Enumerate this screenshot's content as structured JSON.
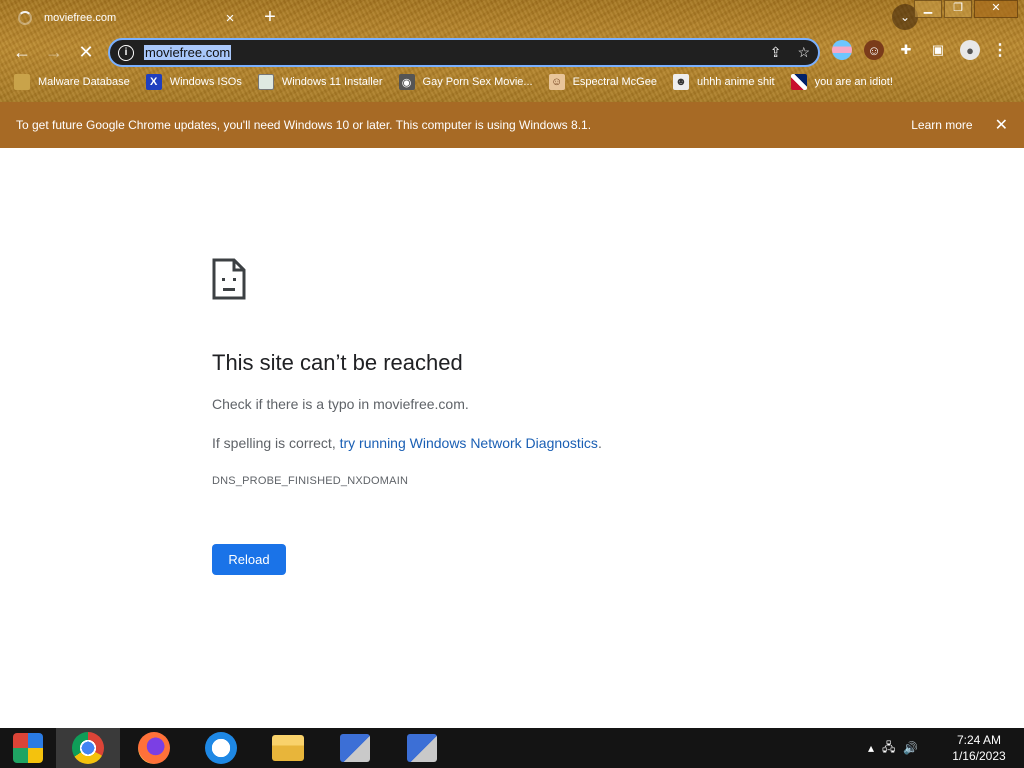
{
  "browser": {
    "tab_title": "moviefree.com",
    "tab_close": "×",
    "new_tab": "+",
    "address": "moviefree.com",
    "bookmarks": [
      {
        "label": "Malware Database",
        "icon": "folder-icon"
      },
      {
        "label": "Windows ISOs",
        "icon": "x-logo-icon"
      },
      {
        "label": "Windows 11 Installer",
        "icon": "image-icon"
      },
      {
        "label": "Gay Porn Sex Movie...",
        "icon": "robot-icon"
      },
      {
        "label": "Espectral McGee",
        "icon": "face-icon"
      },
      {
        "label": "uhhh anime shit",
        "icon": "anime-face-icon"
      },
      {
        "label": "you are an idiot!",
        "icon": "flag-icon"
      }
    ]
  },
  "infobar": {
    "message": "To get future Google Chrome updates, you'll need Windows 10 or later. This computer is using Windows 8.1.",
    "learn_more": "Learn more",
    "close": "✕"
  },
  "error_page": {
    "title": "This site can’t be reached",
    "line1": "Check if there is a typo in moviefree.com.",
    "line2_prefix": "If spelling is correct, ",
    "line2_link": "try running Windows Network Diagnostics",
    "line2_suffix": ".",
    "code": "DNS_PROBE_FINISHED_NXDOMAIN",
    "reload_label": "Reload"
  },
  "taskbar": {
    "items": [
      "start-orb",
      "chrome",
      "firefox",
      "browser-o",
      "file-explorer",
      "installer-1",
      "installer-2"
    ],
    "time": "7:24 AM",
    "date": "1/16/2023"
  },
  "colors": {
    "theme": "#a47520",
    "infobar": "#a76a25",
    "button": "#1a73e8",
    "link": "#1a5fb4"
  }
}
